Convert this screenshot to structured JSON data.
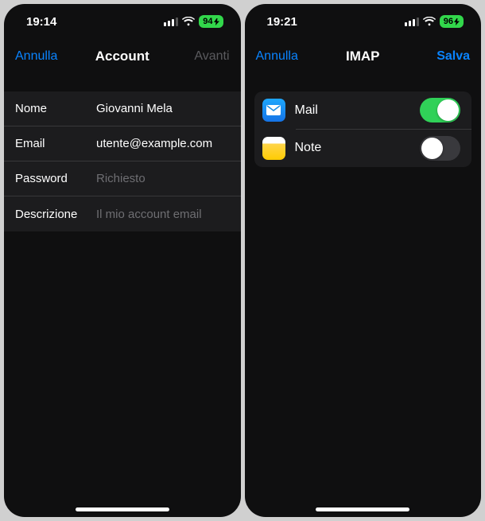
{
  "left": {
    "status": {
      "time": "19:14",
      "battery": "94"
    },
    "nav": {
      "cancel": "Annulla",
      "title": "Account",
      "next": "Avanti"
    },
    "form": {
      "name": {
        "label": "Nome",
        "value": "Giovanni Mela"
      },
      "email": {
        "label": "Email",
        "value": "utente@example.com"
      },
      "password": {
        "label": "Password",
        "placeholder": "Richiesto"
      },
      "description": {
        "label": "Descrizione",
        "placeholder": "Il mio account email"
      }
    }
  },
  "right": {
    "status": {
      "time": "19:21",
      "battery": "96"
    },
    "nav": {
      "cancel": "Annulla",
      "title": "IMAP",
      "save": "Salva"
    },
    "rows": {
      "mail": {
        "label": "Mail",
        "on": true
      },
      "notes": {
        "label": "Note",
        "on": false
      }
    }
  }
}
